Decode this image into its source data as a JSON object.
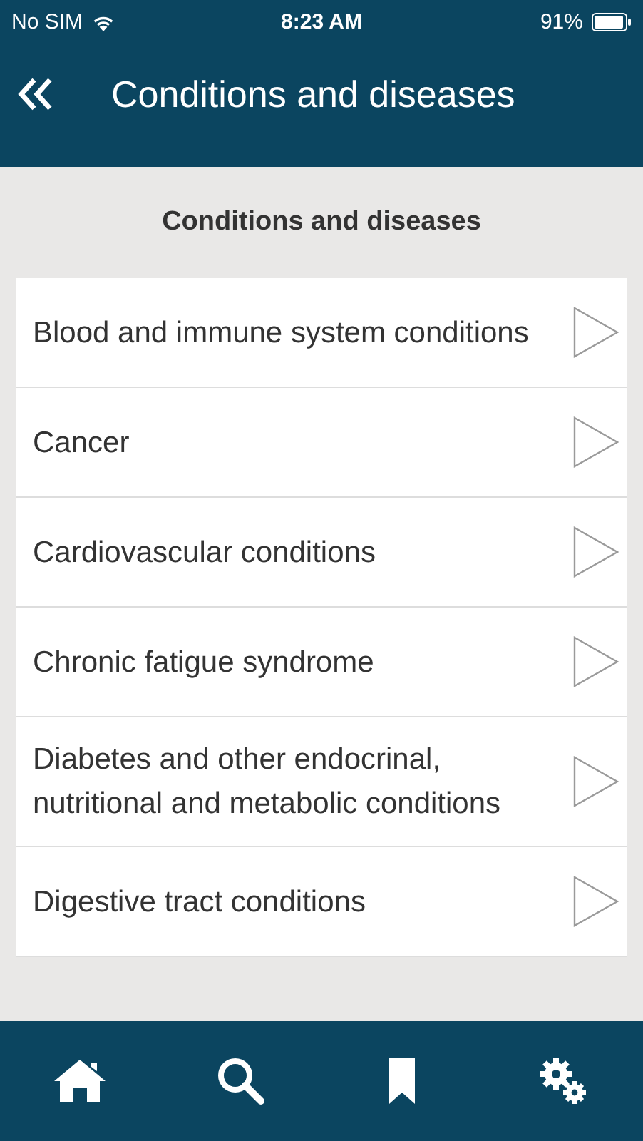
{
  "status_bar": {
    "carrier": "No SIM",
    "time": "8:23 AM",
    "battery": "91%"
  },
  "header": {
    "title": "Conditions and diseases"
  },
  "section_title": "Conditions and diseases",
  "items": [
    {
      "label": "Blood and immune system conditions"
    },
    {
      "label": "Cancer"
    },
    {
      "label": "Cardiovascular conditions"
    },
    {
      "label": "Chronic fatigue syndrome"
    },
    {
      "label": "Diabetes and other endocrinal, nutritional and metabolic conditions"
    },
    {
      "label": "Digestive tract conditions"
    }
  ],
  "tab_bar": [
    {
      "kind": "home"
    },
    {
      "kind": "search"
    },
    {
      "kind": "bookmark"
    },
    {
      "kind": "settings"
    }
  ]
}
